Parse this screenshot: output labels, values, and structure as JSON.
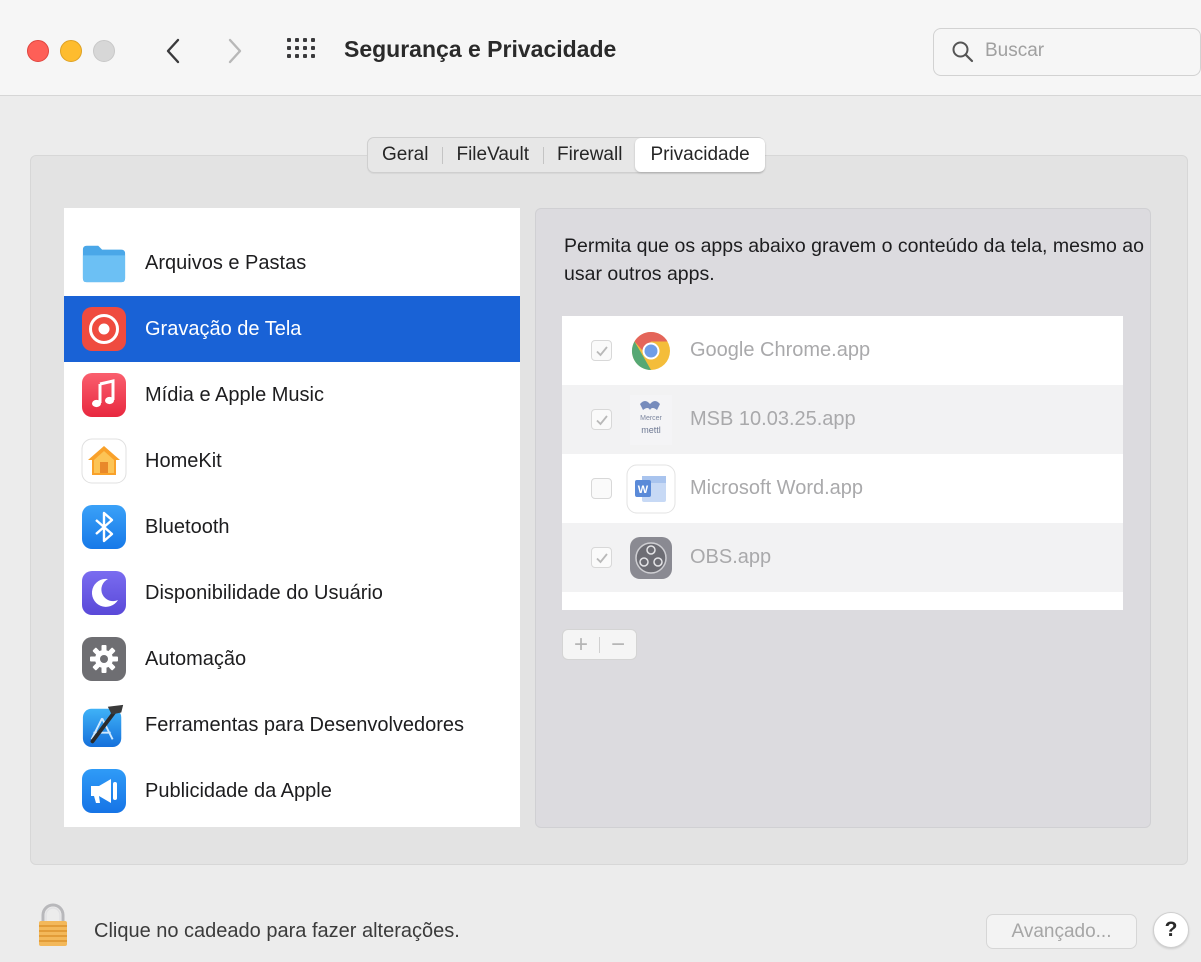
{
  "window": {
    "title": "Segurança e Privacidade",
    "search_placeholder": "Buscar"
  },
  "tabs": [
    {
      "label": "Geral",
      "active": false
    },
    {
      "label": "FileVault",
      "active": false
    },
    {
      "label": "Firewall",
      "active": false
    },
    {
      "label": "Privacidade",
      "active": true
    }
  ],
  "sidebar": {
    "selected": "Gravação de Tela",
    "items": [
      {
        "label": "Arquivos e Pastas",
        "icon": "folder-icon"
      },
      {
        "label": "Gravação de Tela",
        "icon": "screen-recording-icon"
      },
      {
        "label": "Mídia e Apple Music",
        "icon": "music-icon"
      },
      {
        "label": "HomeKit",
        "icon": "homekit-icon"
      },
      {
        "label": "Bluetooth",
        "icon": "bluetooth-icon"
      },
      {
        "label": "Disponibilidade do Usuário",
        "icon": "moon-icon"
      },
      {
        "label": "Automação",
        "icon": "gear-icon"
      },
      {
        "label": "Ferramentas para Desenvolvedores",
        "icon": "xcode-hammer-icon"
      },
      {
        "label": "Publicidade da Apple",
        "icon": "megaphone-icon"
      }
    ]
  },
  "main": {
    "description": "Permita que os apps abaixo gravem o conteúdo da tela, mesmo ao usar outros apps.",
    "apps": [
      {
        "name": "Google Chrome.app",
        "checked": true,
        "icon": "chrome-icon"
      },
      {
        "name": "MSB 10.03.25.app",
        "checked": true,
        "icon": "mercer-mettl-icon"
      },
      {
        "name": "Microsoft Word.app",
        "checked": false,
        "icon": "word-icon"
      },
      {
        "name": "OBS.app",
        "checked": true,
        "icon": "obs-icon"
      }
    ],
    "add_label": "+",
    "remove_label": "−"
  },
  "footer": {
    "lock_text": "Clique no cadeado para fazer alterações.",
    "advanced_label": "Avançado...",
    "help_label": "?"
  },
  "colors": {
    "selection": "#1962d6",
    "close": "#fe5f57",
    "minimize": "#febc2e"
  }
}
